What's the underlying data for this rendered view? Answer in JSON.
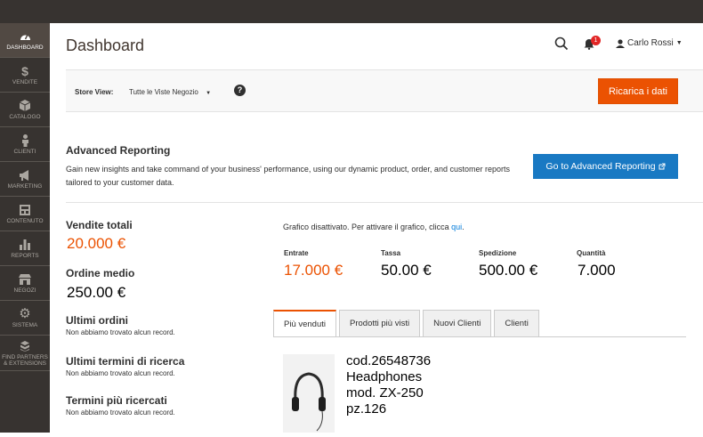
{
  "sidebar": {
    "items": [
      {
        "label": "DASHBOARD",
        "icon": "dashboard-icon"
      },
      {
        "label": "VENDITE",
        "icon": "dollar-icon"
      },
      {
        "label": "CATALOGO",
        "icon": "cube-icon"
      },
      {
        "label": "CLIENTI",
        "icon": "person-icon"
      },
      {
        "label": "MARKETING",
        "icon": "megaphone-icon"
      },
      {
        "label": "CONTENUTO",
        "icon": "layout-icon"
      },
      {
        "label": "REPORTS",
        "icon": "bar-chart-icon"
      },
      {
        "label": "NEGOZI",
        "icon": "store-icon"
      },
      {
        "label": "SISTEMA",
        "icon": "gear-icon"
      },
      {
        "label": "FIND PARTNERS & EXTENSIONS",
        "icon": "boxes-icon"
      }
    ]
  },
  "header": {
    "title": "Dashboard",
    "notifications_count": "1",
    "user_name": "Carlo Rossi"
  },
  "store_view": {
    "label": "Store View:",
    "selected": "Tutte le Viste Negozio",
    "help": "?",
    "reload_button": "Ricarica i dati"
  },
  "advanced_reporting": {
    "title": "Advanced Reporting",
    "description": "Gain new insights and take command of your business' performance, using our dynamic product, order, and customer reports tailored to your customer data.",
    "button": "Go to Advanced Reporting"
  },
  "stats": {
    "total_sales_label": "Vendite totali",
    "total_sales_value": "20.000 €",
    "avg_order_label": "Ordine medio",
    "avg_order_value": "250.00 €",
    "last_orders_label": "Ultimi ordini",
    "last_orders_empty": "Non abbiamo trovato alcun record.",
    "last_search_label": "Ultimi termini di ricerca",
    "last_search_empty": "Non abbiamo trovato alcun record.",
    "top_search_label": "Termini più ricercati",
    "top_search_empty": "Non abbiamo trovato alcun record."
  },
  "chart_notice": {
    "text": "Grafico disattivato. Per attivare il grafico, clicca ",
    "link": "qui",
    "end": "."
  },
  "totals": [
    {
      "label": "Entrate",
      "value": "17.000 €"
    },
    {
      "label": "Tassa",
      "value": "50.00 €"
    },
    {
      "label": "Spedizione",
      "value": "500.00 €"
    },
    {
      "label": "Quantità",
      "value": "7.000"
    }
  ],
  "tabs": [
    "Più venduti",
    "Prodotti più visti",
    "Nuovi Clienti",
    "Clienti"
  ],
  "product": {
    "line1": "cod.26548736",
    "line2": "Headphones",
    "line3": "mod. ZX-250",
    "line4": "pz.126",
    "image_icon": "headphones-icon"
  },
  "colors": {
    "accent": "#eb5202",
    "primary_button": "#1979c3",
    "sidebar": "#373330"
  }
}
